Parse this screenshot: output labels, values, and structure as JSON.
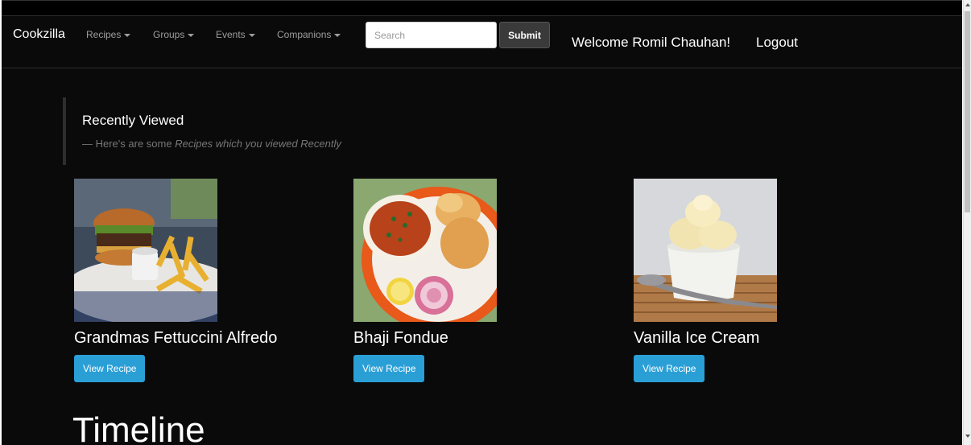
{
  "navbar": {
    "brand": "Cookzilla",
    "menus": [
      {
        "label": "Recipes"
      },
      {
        "label": "Groups"
      },
      {
        "label": "Events"
      },
      {
        "label": "Companions"
      }
    ],
    "search": {
      "placeholder": "Search",
      "value": ""
    },
    "submit_label": "Submit",
    "welcome": "Welcome Romil Chauhan!",
    "logout": "Logout"
  },
  "recently_viewed": {
    "title": "Recently Viewed",
    "subtitle_prefix": "— Here's are some",
    "subtitle_emphasis": "Recipes which you viewed Recently"
  },
  "recipes": [
    {
      "title": "Grandmas Fettuccini Alfredo",
      "button": "View Recipe",
      "image": "burger-and-fries-photo"
    },
    {
      "title": "Bhaji Fondue",
      "button": "View Recipe",
      "image": "pav-bhaji-photo"
    },
    {
      "title": "Vanilla Ice Cream",
      "button": "View Recipe",
      "image": "vanilla-ice-cream-photo"
    }
  ],
  "timeline_heading": "Timeline",
  "colors": {
    "navbar_bg": "#0a0a0a",
    "page_bg": "#0a0a0a",
    "primary_button": "#2a9fd6",
    "submit_button": "#3a3a3a"
  }
}
